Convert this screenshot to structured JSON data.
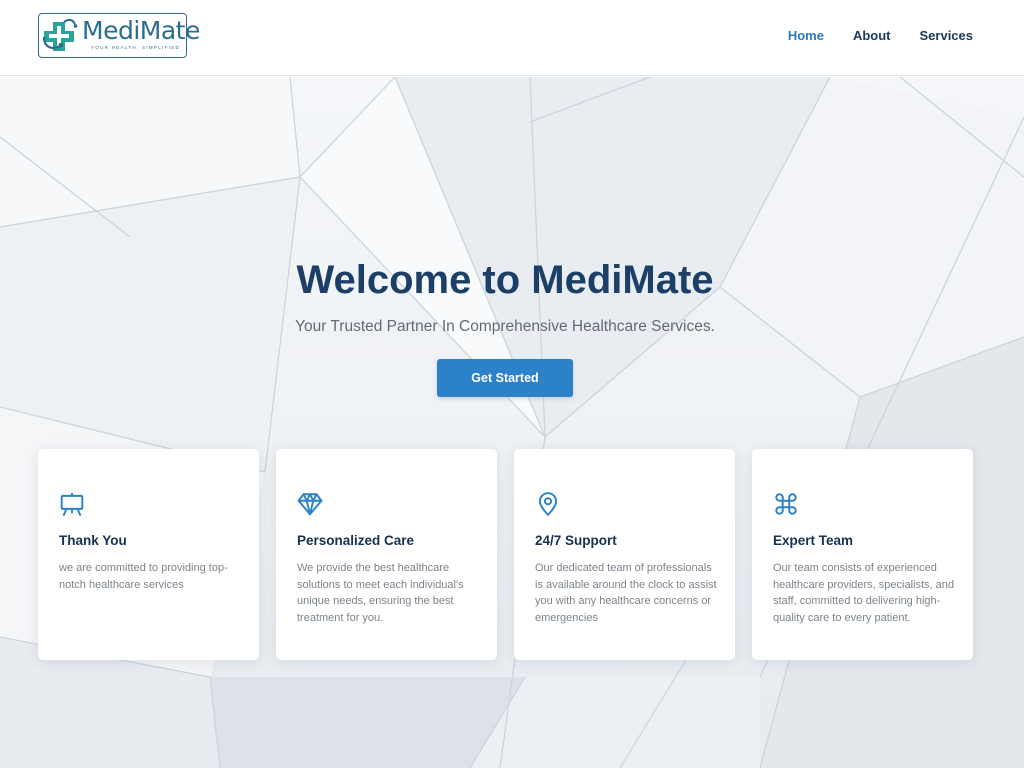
{
  "header": {
    "logo": {
      "name": "MediMate",
      "tagline": "YOUR HEALTH, SIMPLIFIED"
    },
    "nav": [
      {
        "label": "Home",
        "active": true
      },
      {
        "label": "About",
        "active": false
      },
      {
        "label": "Services",
        "active": false
      }
    ]
  },
  "hero": {
    "title": "Welcome to MediMate",
    "subtitle": "Your Trusted Partner In Comprehensive Healthcare Services.",
    "cta_label": "Get Started"
  },
  "features": [
    {
      "icon": "easel-icon",
      "title": "Thank You",
      "text": "we are committed to providing top-notch healthcare services"
    },
    {
      "icon": "gem-icon",
      "title": "Personalized Care",
      "text": "We provide the best healthcare solutions to meet each individual's unique needs, ensuring the best treatment for you."
    },
    {
      "icon": "map-pin-icon",
      "title": "24/7 Support",
      "text": "Our dedicated team of professionals is available around the clock to assist you with any healthcare concerns or emergencies"
    },
    {
      "icon": "command-icon",
      "title": "Expert Team",
      "text": "Our team consists of experienced healthcare providers, specialists, and staff, committed to delivering high-quality care to every patient."
    }
  ],
  "colors": {
    "brand": "#2b6d8e",
    "title": "#1b3f66",
    "button": "#2c82c9",
    "nav_active": "#2a7ab6",
    "icon": "#2c82c9"
  }
}
